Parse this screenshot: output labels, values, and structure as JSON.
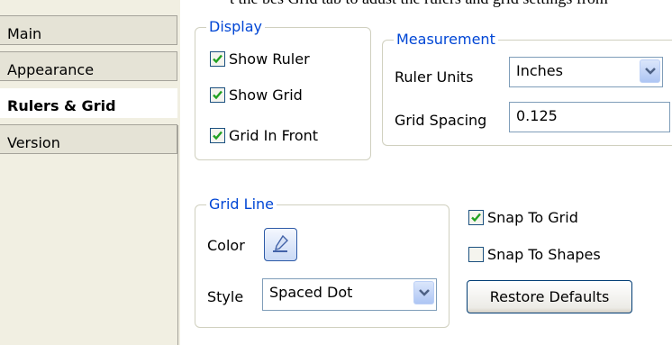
{
  "clipped_text": "t the bes Grid tab to adust the rulers and grid settings from",
  "tabs": [
    {
      "label": "Main",
      "active": false
    },
    {
      "label": "Appearance",
      "active": false
    },
    {
      "label": "Rulers & Grid",
      "active": true
    },
    {
      "label": "Version",
      "active": false
    }
  ],
  "display": {
    "legend": "Display",
    "show_ruler": {
      "label": "Show Ruler",
      "checked": true
    },
    "show_grid": {
      "label": "Show Grid",
      "checked": true
    },
    "grid_in_front": {
      "label": "Grid In Front",
      "checked": true
    }
  },
  "measurement": {
    "legend": "Measurement",
    "ruler_units_label": "Ruler Units",
    "ruler_units_value": "Inches",
    "grid_spacing_label": "Grid Spacing",
    "grid_spacing_value": "0.125"
  },
  "grid_line": {
    "legend": "Grid Line",
    "color_label": "Color",
    "style_label": "Style",
    "style_value": "Spaced Dot"
  },
  "snap_to_grid": {
    "label": "Snap To Grid",
    "checked": true
  },
  "snap_to_shapes": {
    "label": "Snap To Shapes",
    "checked": false
  },
  "restore_defaults_label": "Restore Defaults",
  "colors": {
    "legend": "#0046d5",
    "check": "#21a121",
    "border": "#d0d0bf"
  }
}
